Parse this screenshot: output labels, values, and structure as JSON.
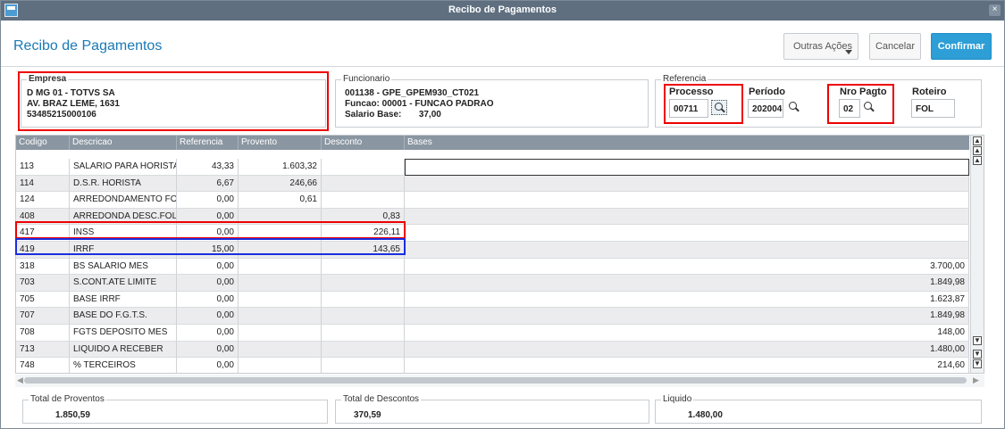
{
  "window": {
    "title": "Recibo de Pagamentos"
  },
  "header": {
    "page_title": "Recibo de Pagamentos",
    "outras_label": "Outras Ações",
    "cancel_label": "Cancelar",
    "confirm_label": "Confirmar"
  },
  "empresa": {
    "legend": "Empresa",
    "lines": [
      "D MG 01  - TOTVS SA",
      "AV. BRAZ LEME, 1631",
      "53485215000106"
    ]
  },
  "funcionario": {
    "legend": "Funcionario",
    "lines": [
      "001138 - GPE_GPEM930_CT021",
      "Funcao: 00001 - FUNCAO PADRAO",
      "Salario Base:       37,00"
    ]
  },
  "referencia": {
    "legend": "Referencia",
    "processo_label": "Processo",
    "processo_value": "00711",
    "periodo_label": "Período",
    "periodo_value": "202004",
    "nro_label": "Nro Pagto",
    "nro_value": "02",
    "roteiro_label": "Roteiro",
    "roteiro_value": "FOL"
  },
  "table": {
    "columns": [
      "Codigo",
      "Descricao",
      "Referencia",
      "Provento",
      "Desconto",
      "Bases"
    ],
    "rows": [
      [
        "113",
        "SALARIO PARA HORISTA",
        "43,33",
        "1.603,32",
        "",
        ""
      ],
      [
        "114",
        "D.S.R. HORISTA",
        "6,67",
        "246,66",
        "",
        ""
      ],
      [
        "124",
        "ARREDONDAMENTO FOLHA",
        "0,00",
        "0,61",
        "",
        ""
      ],
      [
        "408",
        "ARREDONDA DESC.FOLH",
        "0,00",
        "",
        "0,83",
        ""
      ],
      [
        "417",
        "INSS",
        "0,00",
        "",
        "226,11",
        ""
      ],
      [
        "419",
        "IRRF",
        "15,00",
        "",
        "143,65",
        ""
      ],
      [
        "318",
        "BS SALARIO MES",
        "0,00",
        "",
        "",
        "3.700,00"
      ],
      [
        "703",
        "S.CONT.ATE LIMITE",
        "0,00",
        "",
        "",
        "1.849,98"
      ],
      [
        "705",
        "BASE IRRF",
        "0,00",
        "",
        "",
        "1.623,87"
      ],
      [
        "707",
        "BASE DO F.G.T.S.",
        "0,00",
        "",
        "",
        "1.849,98"
      ],
      [
        "708",
        "FGTS DEPOSITO MES",
        "0,00",
        "",
        "",
        "148,00"
      ],
      [
        "713",
        "LIQUIDO A RECEBER",
        "0,00",
        "",
        "",
        "1.480,00"
      ],
      [
        "748",
        "% TERCEIROS",
        "0,00",
        "",
        "",
        "214,60"
      ]
    ]
  },
  "totals": {
    "proventos_label": "Total de Proventos",
    "proventos_value": "1.850,59",
    "descontos_label": "Total de Descontos",
    "descontos_value": "370,59",
    "liquido_label": "Liquido",
    "liquido_value": "1.480,00"
  },
  "colors": {
    "accent": "#2e9ed6",
    "titlebar": "#5f6f80",
    "highlight_red": "#e00000",
    "highlight_blue": "#1a2ee0"
  }
}
